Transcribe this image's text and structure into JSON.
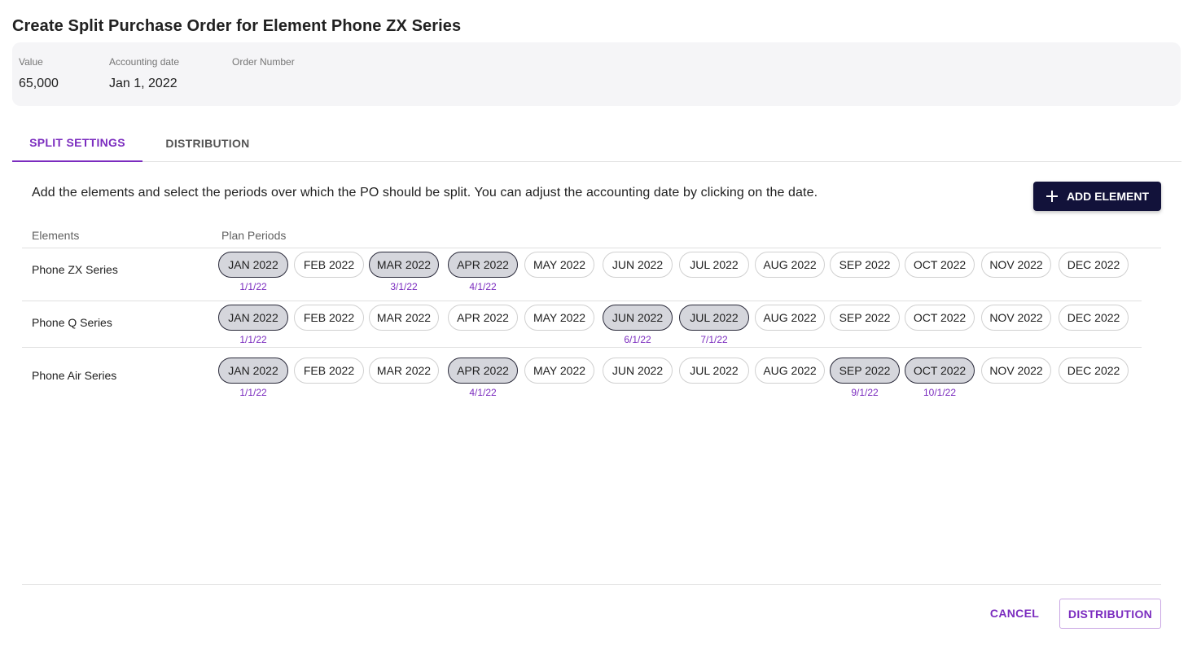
{
  "dialog": {
    "title": "Create Split Purchase Order for Element Phone ZX Series"
  },
  "summary": {
    "value": {
      "label": "Value",
      "value": "65,000"
    },
    "accounting_date": {
      "label": "Accounting date",
      "value": "Jan 1, 2022"
    },
    "order_number": {
      "label": "Order Number",
      "value": ""
    }
  },
  "tabs": [
    {
      "label": "SPLIT SETTINGS",
      "active": true
    },
    {
      "label": "DISTRIBUTION",
      "active": false
    }
  ],
  "instructions": "Add the elements and select the periods over which the PO should be split. You can adjust the accounting date by clicking on the date.",
  "add_element_label": "ADD ELEMENT",
  "columns": {
    "elements": "Elements",
    "plan_periods": "Plan Periods"
  },
  "periods": [
    "JAN 2022",
    "FEB 2022",
    "MAR 2022",
    "APR 2022",
    "MAY 2022",
    "JUN 2022",
    "JUL 2022",
    "AUG 2022",
    "SEP 2022",
    "OCT 2022",
    "NOV 2022",
    "DEC 2022"
  ],
  "rows": [
    {
      "name": "Phone ZX Series",
      "selected": [
        {
          "period": "JAN 2022",
          "date": "1/1/22"
        },
        {
          "period": "MAR 2022",
          "date": "3/1/22"
        },
        {
          "period": "APR 2022",
          "date": "4/1/22"
        }
      ]
    },
    {
      "name": "Phone Q Series",
      "selected": [
        {
          "period": "JAN 2022",
          "date": "1/1/22"
        },
        {
          "period": "JUN 2022",
          "date": "6/1/22"
        },
        {
          "period": "JUL 2022",
          "date": "7/1/22"
        }
      ]
    },
    {
      "name": "Phone Air Series",
      "selected": [
        {
          "period": "JAN 2022",
          "date": "1/1/22"
        },
        {
          "period": "APR 2022",
          "date": "4/1/22"
        },
        {
          "period": "SEP 2022",
          "date": "9/1/22"
        },
        {
          "period": "OCT 2022",
          "date": "10/1/22"
        }
      ]
    }
  ],
  "footer": {
    "cancel_label": "CANCEL",
    "distribution_label": "DISTRIBUTION"
  },
  "colors": {
    "accent": "#7b2cbf",
    "primary_button": "#12123a",
    "selected_chip": "#d5d6dc"
  }
}
